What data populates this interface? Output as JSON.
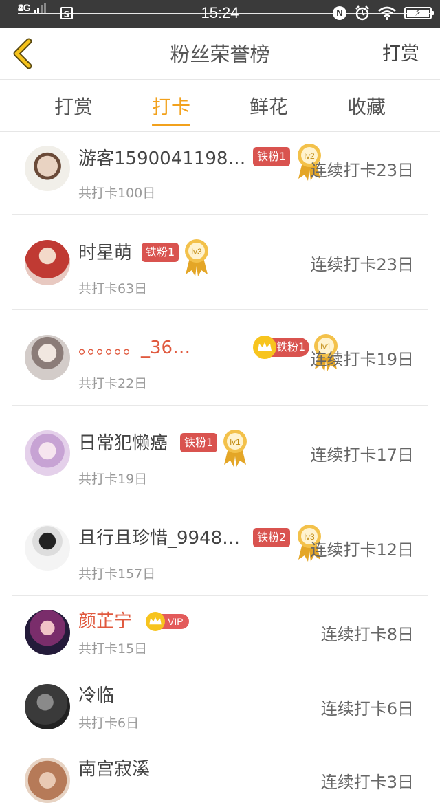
{
  "status_bar": {
    "net_top": "4G",
    "net_bottom": "2G",
    "sim_icon": "S",
    "time": "15:24",
    "nfc": "N"
  },
  "header": {
    "title": "粉丝荣誉榜",
    "action": "打赏"
  },
  "tabs": [
    {
      "label": "打赏",
      "active": false
    },
    {
      "label": "打卡",
      "active": true
    },
    {
      "label": "鲜花",
      "active": false
    },
    {
      "label": "收藏",
      "active": false
    }
  ],
  "rows": [
    {
      "name": "游客1590041198…",
      "fan_badge": "铁粉1",
      "level": "lv2",
      "total": "共打卡100日",
      "streak": "连续打卡23日"
    },
    {
      "name": "时星萌",
      "fan_badge": "铁粉1",
      "level": "lv3",
      "total": "共打卡63日",
      "streak": "连续打卡23日"
    },
    {
      "name": "。。。。。。_36…",
      "fan_badge": "铁粉1",
      "level": "lv1",
      "total": "共打卡22日",
      "streak": "连续打卡19日"
    },
    {
      "name": "日常犯懒癌",
      "fan_badge": "铁粉1",
      "level": "lv1",
      "total": "共打卡19日",
      "streak": "连续打卡17日"
    },
    {
      "name": "且行且珍惜_9948…",
      "fan_badge": "铁粉2",
      "level": "lv3",
      "total": "共打卡157日",
      "streak": "连续打卡12日"
    },
    {
      "name": "颜芷宁",
      "vip_badge": "VIP",
      "total": "共打卡15日",
      "streak": "连续打卡8日"
    },
    {
      "name": "冷临",
      "total": "共打卡6日",
      "streak": "连续打卡6日"
    },
    {
      "name": "南宫寂溪",
      "total": "",
      "streak": "连续打卡3日"
    }
  ],
  "colors": {
    "accent": "#f2a11c",
    "fan_badge": "#d9534f",
    "vip_name": "#e0593e",
    "status_bar": "#3a3a3a"
  },
  "icons": [
    "back-chevron-icon",
    "crown-icon",
    "medal-icon",
    "wifi-icon",
    "alarm-icon",
    "battery-icon"
  ]
}
